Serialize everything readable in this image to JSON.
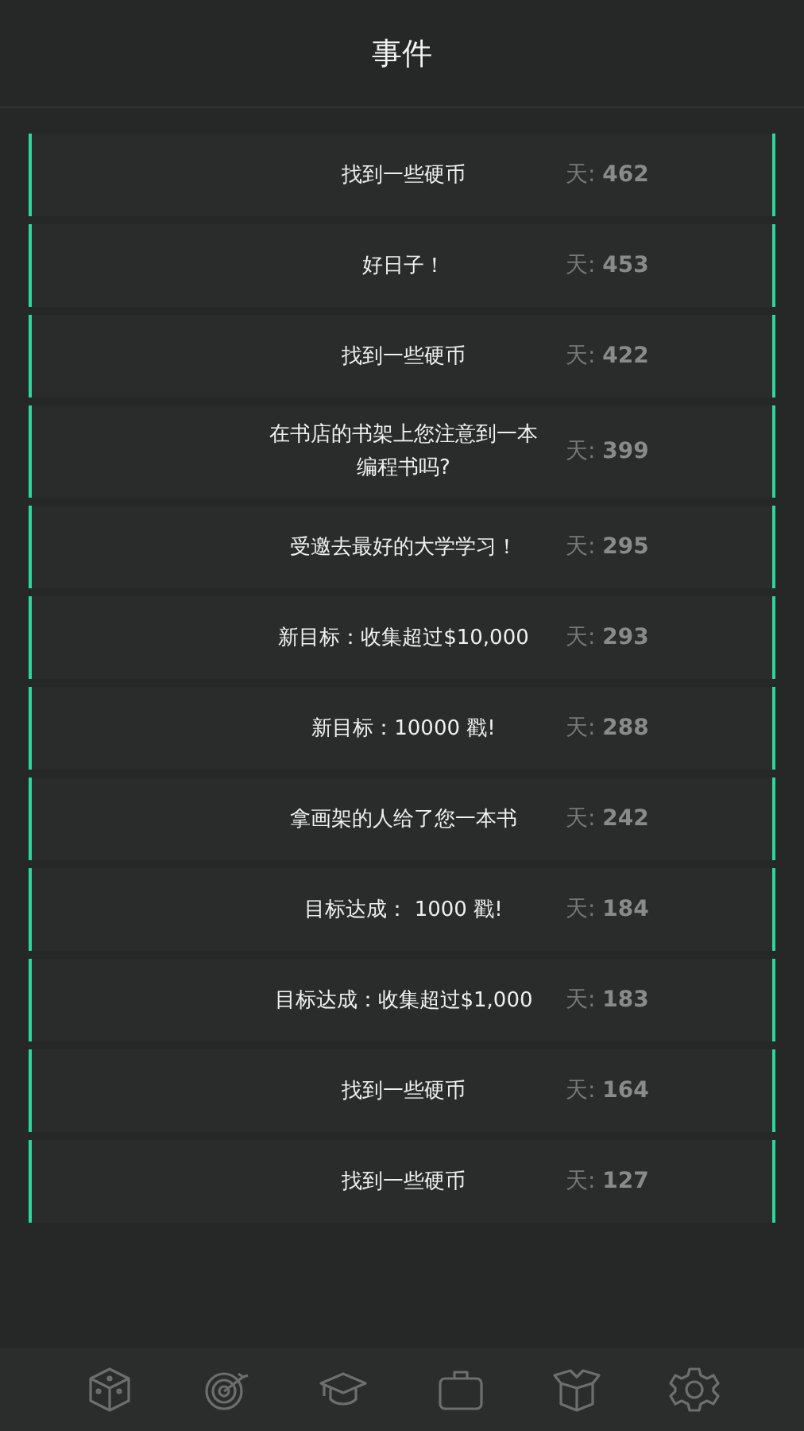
{
  "title": "事件",
  "events": [
    {
      "text": "找到一些硬币",
      "day": "天: **462**"
    },
    {
      "text": "好日子！",
      "day": "天: **453**"
    },
    {
      "text": "找到一些硬币",
      "day": "天: **422**"
    },
    {
      "text": "在书店的书架上您注意到一本编程书吗?",
      "day": "天: **399**"
    },
    {
      "text": "受邀去最好的大学学习！",
      "day": "天: **295**"
    },
    {
      "text": "新目标：收集超过$10,000",
      "day": "天: **293**"
    },
    {
      "text": "新目标：10000 戳!",
      "day": "天: **288**"
    },
    {
      "text": "拿画架的人给了您一本书",
      "day": "天: **242**"
    },
    {
      "text": "目标达成： 1000 戳!",
      "day": "天: **184**"
    },
    {
      "text": "目标达成：收集超过$1,000",
      "day": "天: **183**"
    },
    {
      "text": "找到一些硬币",
      "day": "天: **164**"
    },
    {
      "text": "找到一些硬币",
      "day": "天: **127**"
    }
  ],
  "tabs": [
    {
      "kind": "cube"
    },
    {
      "kind": "target"
    },
    {
      "kind": "cap"
    },
    {
      "kind": "briefcase"
    },
    {
      "kind": "box"
    },
    {
      "kind": "gear"
    }
  ]
}
